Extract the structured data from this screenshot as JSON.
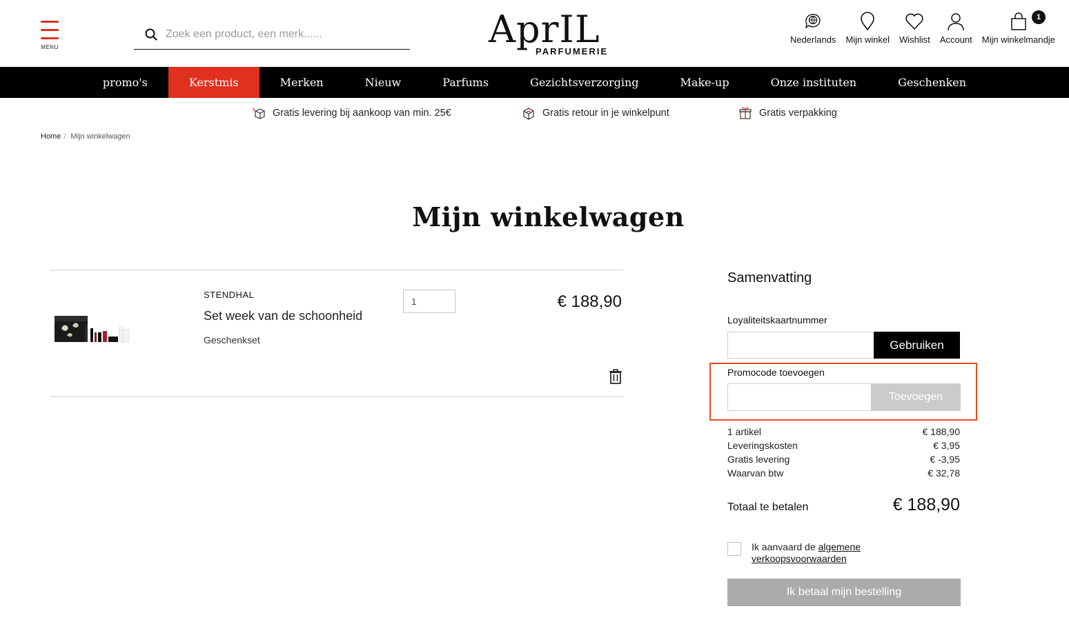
{
  "header": {
    "menu_label": "MENU",
    "search_placeholder": "Zoek een product, een merk......",
    "logo_main": "AprIL",
    "logo_sub": "PARFUMERIE",
    "actions": [
      {
        "label": "Nederlands",
        "icon": "globe-chat-icon"
      },
      {
        "label": "Mijn winkel",
        "icon": "map-pin-icon"
      },
      {
        "label": "Wishlist",
        "icon": "heart-icon"
      },
      {
        "label": "Account",
        "icon": "user-icon"
      },
      {
        "label": "Mijn winkelmandje",
        "icon": "shopping-bag-icon"
      }
    ],
    "cart_count": "1"
  },
  "nav": {
    "items": [
      "promo's",
      "Kerstmis",
      "Merken",
      "Nieuw",
      "Parfums",
      "Gezichtsverzorging",
      "Make-up",
      "Onze instituten",
      "Geschenken"
    ],
    "active_index": 1
  },
  "usps": [
    {
      "text": "Gratis levering bij aankoop van min. 25€",
      "icon": "delivery-box-icon"
    },
    {
      "text": "Gratis retour in je winkelpunt",
      "icon": "return-box-icon"
    },
    {
      "text": "Gratis verpakking",
      "icon": "gift-icon"
    }
  ],
  "breadcrumb": {
    "home": "Home",
    "current": "Mijn winkelwagen"
  },
  "page": {
    "title": "Mijn winkelwagen"
  },
  "cart": {
    "items": [
      {
        "brand": "STENDHAL",
        "name": "Set week van de schoonheid",
        "type": "Geschenkset",
        "quantity": "1",
        "price": "€ 188,90"
      }
    ]
  },
  "summary": {
    "title": "Samenvatting",
    "loyalty_label": "Loyaliteitskaartnummer",
    "loyalty_button": "Gebruiken",
    "promo_label": "Promocode toevoegen",
    "promo_button": "Toevoegen",
    "lines": [
      {
        "label": "1 artikel",
        "value": "€ 188,90"
      },
      {
        "label": "Leveringskosten",
        "value": "€ 3,95"
      },
      {
        "label": "Gratis levering",
        "value": "€ -3,95"
      },
      {
        "label": "Waarvan btw",
        "value": "€ 32,78"
      }
    ],
    "total_label": "Totaal te betalen",
    "total_value": "€ 188,90",
    "terms_prefix": "Ik aanvaard de",
    "terms_link": "algemene verkoopsvoorwaarden",
    "pay_button": "Ik betaal mijn bestelling"
  },
  "colors": {
    "accent": "#e0301e",
    "highlight_border": "#e84a1e",
    "nav_bg": "#000000",
    "disabled_button": "#ababab"
  }
}
